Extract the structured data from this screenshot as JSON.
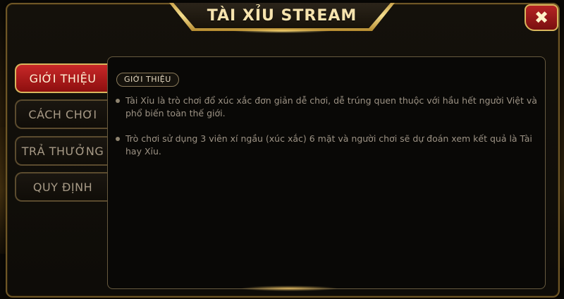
{
  "dialog": {
    "title": "TÀI XỈU STREAM",
    "close_label": "✖"
  },
  "tabs": [
    {
      "label": "GIỚI THIỆU",
      "active": true
    },
    {
      "label": "CÁCH CHƠI",
      "active": false
    },
    {
      "label": "TRẢ THƯỞNG",
      "active": false
    },
    {
      "label": "QUY ĐỊNH",
      "active": false
    }
  ],
  "content": {
    "section_title": "GIỚI THIỆU",
    "paragraphs": [
      "Tài Xỉu là trò chơi đổ xúc xắc đơn giản dễ chơi, dễ trúng quen thuộc với hầu hết người Việt và phổ biến toàn thế giới.",
      "Trò chơi sử dụng 3 viên xí ngầu (xúc xắc) 6 mặt và người chơi sẽ dự đoán xem kết quả là Tài hay Xỉu."
    ]
  },
  "colors": {
    "gold": "#d9b65d",
    "active_tab": "#c82828",
    "text_muted": "#9c9284"
  }
}
